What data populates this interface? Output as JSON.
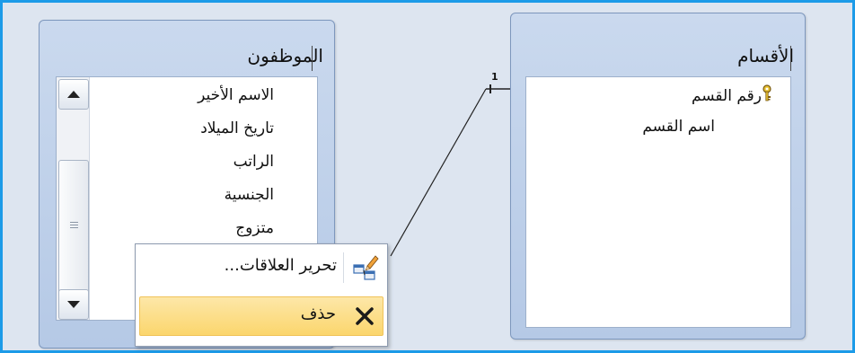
{
  "tables": {
    "employees": {
      "title": "الموظفون",
      "fields": [
        "الاسم الأخير",
        "تاريخ الميلاد",
        "الراتب",
        "الجنسية",
        "متزوج"
      ]
    },
    "departments": {
      "title": "الأقسام",
      "primary_key_field": "رقم القسم",
      "fields": [
        "اسم القسم"
      ]
    }
  },
  "relationship": {
    "one_side_label": "1"
  },
  "context_menu": {
    "items": [
      {
        "label": "تحرير العلاقات...",
        "icon": "edit-relationships-icon",
        "highlighted": false
      },
      {
        "label": "حذف",
        "icon": "delete-x-icon",
        "highlighted": true
      }
    ]
  },
  "colors": {
    "frame_border": "#1c9be8",
    "highlight": "#fbd66d",
    "table_header": "#b5c9e6"
  }
}
